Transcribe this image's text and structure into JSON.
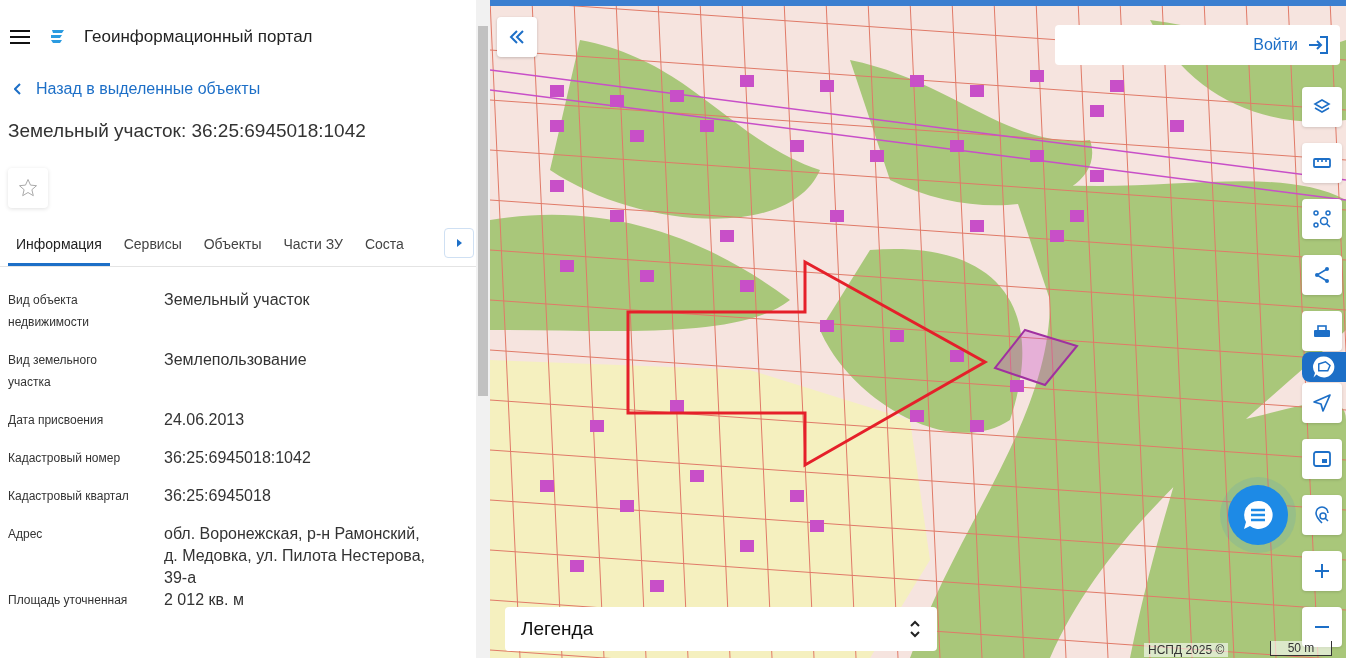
{
  "header": {
    "title": "Геоинформационный портал"
  },
  "back_link": "Назад в выделенные объекты",
  "object_title": "Земельный участок: 36:25:6945018:1042",
  "favorite": {
    "on": false
  },
  "tabs": [
    {
      "label": "Информация",
      "selected": true
    },
    {
      "label": "Сервисы",
      "selected": false
    },
    {
      "label": "Объекты",
      "selected": false
    },
    {
      "label": "Части ЗУ",
      "selected": false
    },
    {
      "label": "Соста",
      "selected": false
    }
  ],
  "properties": [
    {
      "label": "Вид объекта недвижимости",
      "value": "Земельный участок"
    },
    {
      "label": "Вид земельного участка",
      "value": "Землепользование"
    },
    {
      "label": "Дата присвоения",
      "value": "24.06.2013"
    },
    {
      "label": "Кадастровый номер",
      "value": "36:25:6945018:1042"
    },
    {
      "label": "Кадастровый квартал",
      "value": "36:25:6945018"
    },
    {
      "label": "Адрес",
      "value": "обл. Воронежская, р-н Рамонский, д. Медовка, ул. Пилота Нестерова, 39-а"
    },
    {
      "label": "Площадь уточненная",
      "value": "2 012 кв. м"
    }
  ],
  "map": {
    "login": "Войти",
    "legend": "Легенда",
    "attribution": "НСПД 2025 ©",
    "scale": "50 m"
  }
}
